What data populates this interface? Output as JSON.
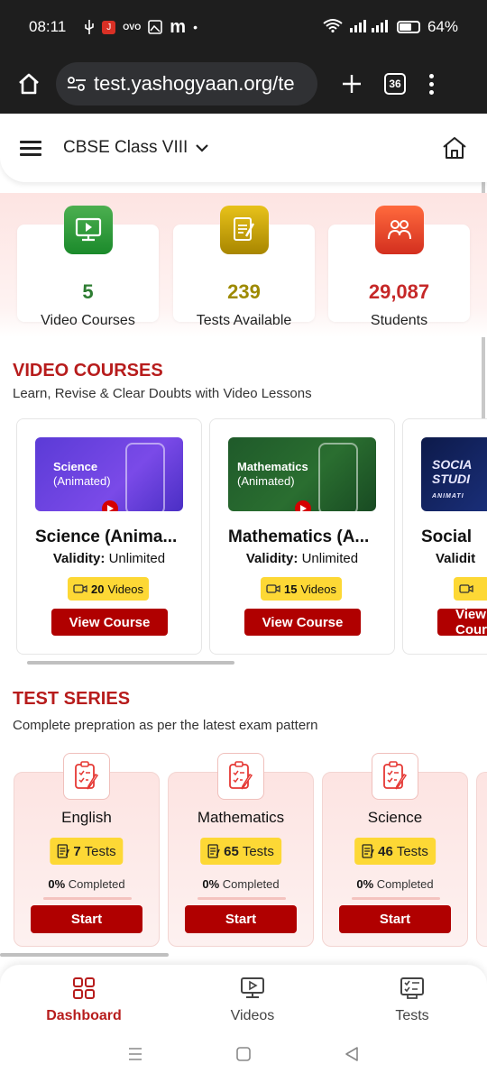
{
  "status_bar": {
    "time": "08:11",
    "battery": "64%"
  },
  "browser": {
    "url": "test.yashogyaan.org/te",
    "tab_count": "36"
  },
  "header": {
    "class_name": "CBSE Class VIII"
  },
  "stats": [
    {
      "value": "5",
      "label": "Video Courses",
      "color": "#2e7d32"
    },
    {
      "value": "239",
      "label": "Tests Available",
      "color": "#9e8a00"
    },
    {
      "value": "29,087",
      "label": "Students",
      "color": "#c62828"
    }
  ],
  "video_section": {
    "title": "VIDEO COURSES",
    "subtitle": "Learn, Revise & Clear Doubts with Video Lessons",
    "validity_label": "Validity:",
    "button_label": "View Course",
    "courses": [
      {
        "thumb_line1": "Science",
        "thumb_line2": "(Animated)",
        "title": "Science (Anima...",
        "validity": "Unlimited",
        "videos_count": "20",
        "videos_word": "Videos"
      },
      {
        "thumb_line1": "Mathematics",
        "thumb_line2": "(Animated)",
        "title": "Mathematics (A...",
        "validity": "Unlimited",
        "videos_count": "15",
        "videos_word": "Videos"
      },
      {
        "thumb_line1": "SOCIA",
        "thumb_line2": "STUDI",
        "thumb_line3": "ANIMATI",
        "title": "Social",
        "validity": "Validit"
      }
    ]
  },
  "test_section": {
    "title": "TEST SERIES",
    "subtitle": "Complete prepration as per the latest exam pattern",
    "button_label": "Start",
    "completed_word": "Completed",
    "tests_word": "Tests",
    "series": [
      {
        "name": "English",
        "count": "7",
        "progress": "0%"
      },
      {
        "name": "Mathematics",
        "count": "65",
        "progress": "0%"
      },
      {
        "name": "Science",
        "count": "46",
        "progress": "0%"
      }
    ]
  },
  "bottom_nav": [
    {
      "label": "Dashboard",
      "icon": "dashboard-grid-icon",
      "active": true
    },
    {
      "label": "Videos",
      "icon": "video-screen-icon",
      "active": false
    },
    {
      "label": "Tests",
      "icon": "checklist-icon",
      "active": false
    }
  ],
  "colors": {
    "brand_red": "#b00000",
    "title_red": "#b71c1c",
    "badge_yellow": "#fdd835"
  }
}
